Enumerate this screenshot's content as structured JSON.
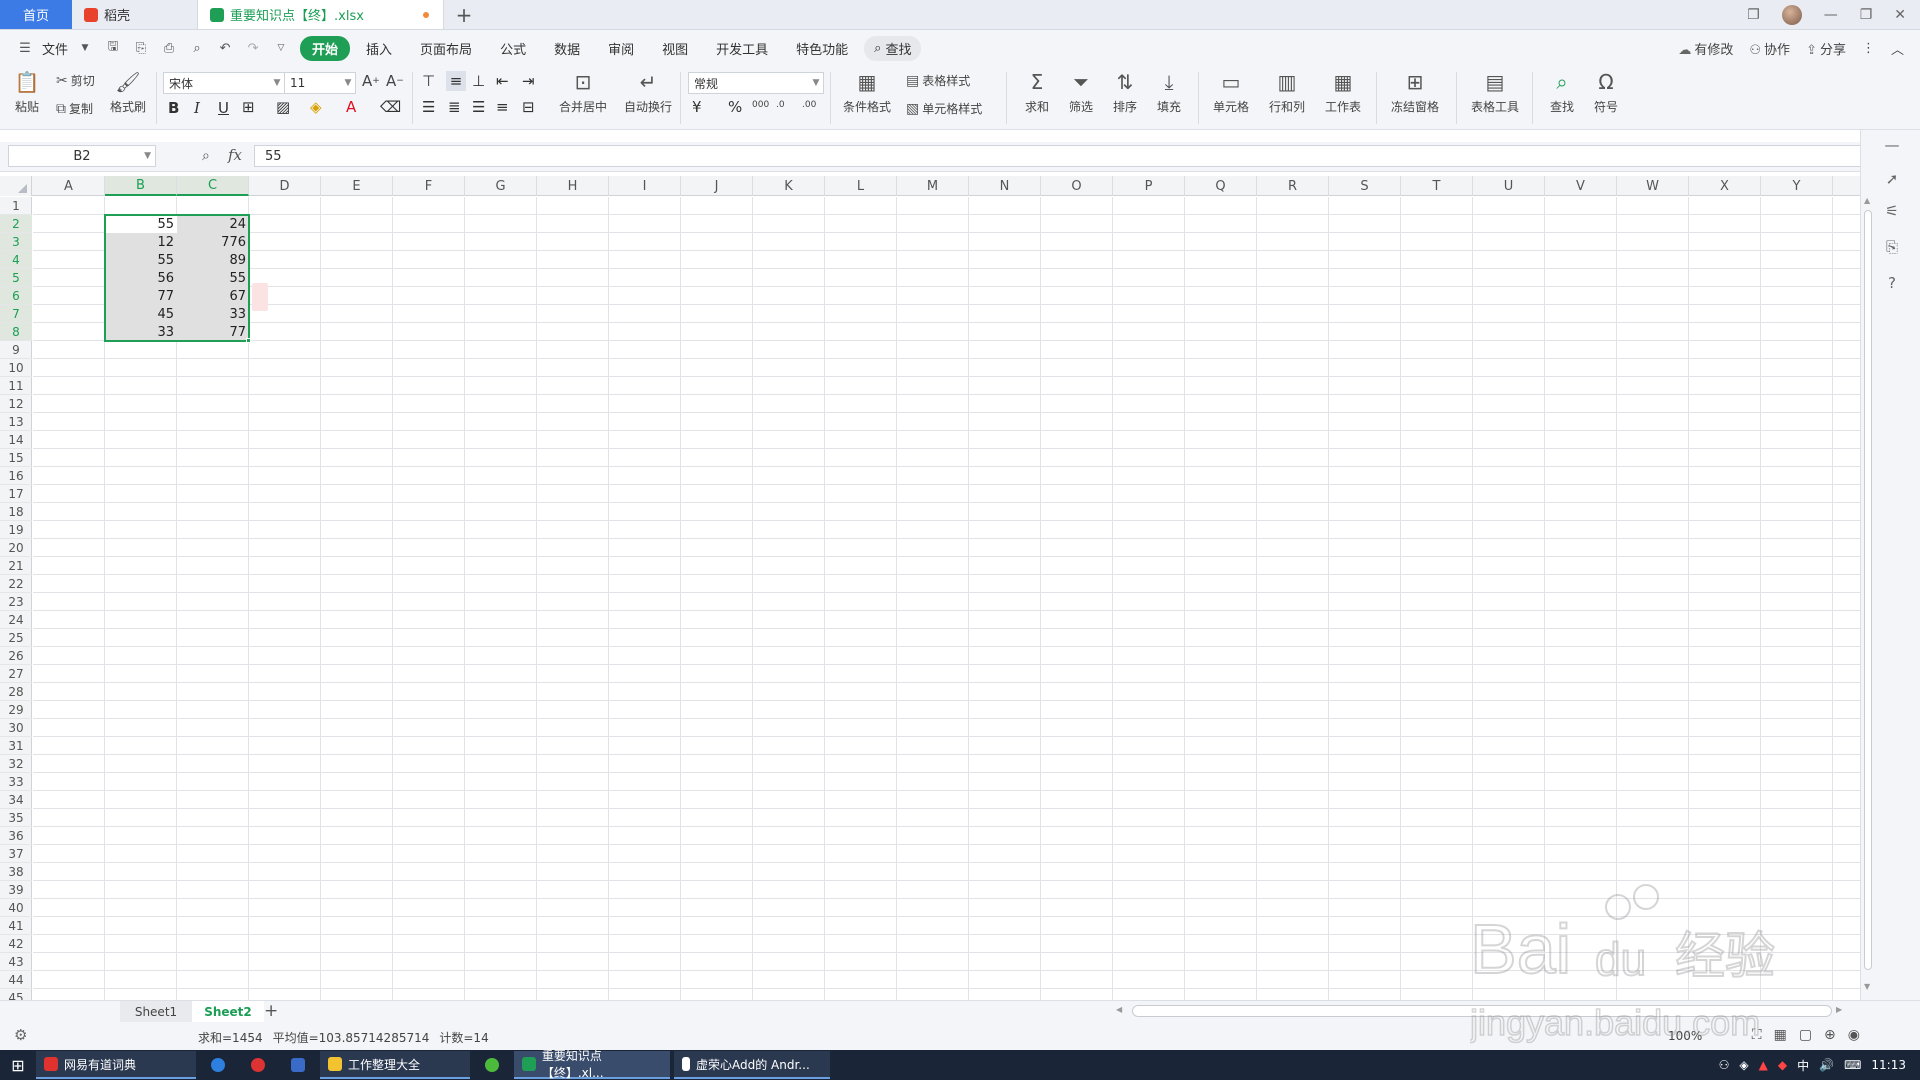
{
  "tabbar": {
    "home_label": "首页",
    "tabs": [
      {
        "label": "稻壳",
        "icon": "daoke-logo-icon",
        "color": "#e8412c"
      },
      {
        "label": "重要知识点【终】.xlsx",
        "icon": "wps-sheet-logo-icon",
        "color": "#1f9f55",
        "modified": true
      }
    ]
  },
  "menubar": {
    "file_label": "文件",
    "tabs": [
      "开始",
      "插入",
      "页面布局",
      "公式",
      "数据",
      "审阅",
      "视图",
      "开发工具",
      "特色功能"
    ],
    "active_tab": "开始",
    "search_label": "查找",
    "right": {
      "modified": "有修改",
      "collab": "协作",
      "share": "分享"
    }
  },
  "ribbon": {
    "paste": "粘贴",
    "cut": "剪切",
    "copy": "复制",
    "format_painter": "格式刷",
    "font_name": "宋体",
    "font_size": "11",
    "merge_center": "合并居中",
    "wrap_text": "自动换行",
    "number_format": "常规",
    "currency_symbol": "¥",
    "percent_symbol": "%",
    "conditional_format": "条件格式",
    "table_style": "表格样式",
    "cell_style": "单元格样式",
    "sum": "求和",
    "filter": "筛选",
    "sort": "排序",
    "fill": "填充",
    "cell": "单元格",
    "row_col": "行和列",
    "worksheet": "工作表",
    "freeze": "冻结窗格",
    "table_tools": "表格工具",
    "find": "查找",
    "symbol": "符号"
  },
  "formula_bar": {
    "cell_ref": "B2",
    "fx": "fx",
    "value": "55"
  },
  "grid": {
    "columns": [
      "A",
      "B",
      "C",
      "D",
      "E",
      "F",
      "G",
      "H",
      "I",
      "J",
      "K",
      "L",
      "M",
      "N",
      "O",
      "P",
      "Q",
      "R",
      "S",
      "T",
      "U",
      "V",
      "W",
      "X",
      "Y"
    ],
    "selected_columns": [
      "B",
      "C"
    ],
    "row_count": 45,
    "selected_rows": [
      2,
      3,
      4,
      5,
      6,
      7,
      8
    ],
    "data": [
      {
        "row": 2,
        "B": "55",
        "C": "24"
      },
      {
        "row": 3,
        "B": "12",
        "C": "776"
      },
      {
        "row": 4,
        "B": "55",
        "C": "89"
      },
      {
        "row": 5,
        "B": "56",
        "C": "55"
      },
      {
        "row": 6,
        "B": "77",
        "C": "67"
      },
      {
        "row": 7,
        "B": "45",
        "C": "33"
      },
      {
        "row": 8,
        "B": "33",
        "C": "77"
      }
    ]
  },
  "sheets": {
    "tabs": [
      "Sheet1",
      "Sheet2"
    ],
    "active": "Sheet2"
  },
  "status": {
    "sum": "求和=1454",
    "average": "平均值=103.85714285714",
    "count": "计数=14",
    "zoom": "100%"
  },
  "taskbar": {
    "items": [
      {
        "label": "网易有道词典",
        "color": "#e0332f"
      },
      {
        "label": "工作整理大全",
        "color": "#f2c230"
      },
      {
        "label": "重要知识点【终】.xl...",
        "color": "#1f9f55"
      },
      {
        "label": "虚荣心Add的 Andr...",
        "color": "#ffffff"
      }
    ],
    "time": "11:13",
    "ime": "中"
  },
  "watermark": {
    "brand": "Bai",
    "brand2": "du",
    "cn": "经验",
    "url": "jingyan.baidu.com"
  }
}
